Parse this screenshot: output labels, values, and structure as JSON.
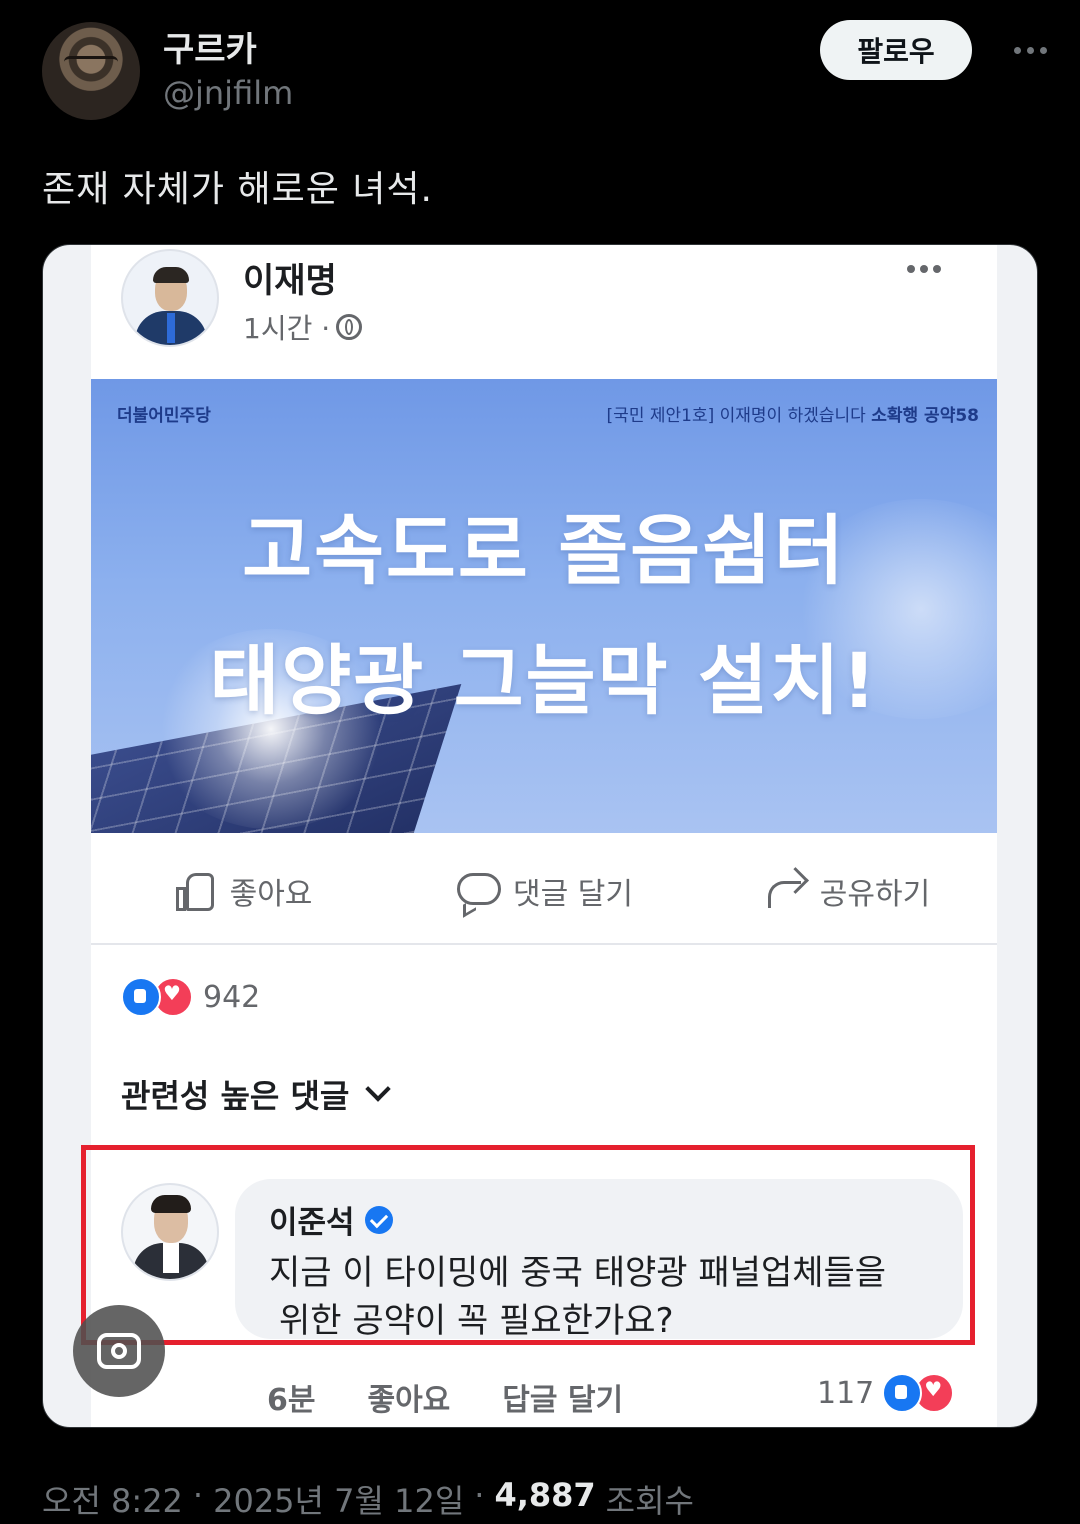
{
  "tweet": {
    "author_name": "구르카",
    "author_handle": "@jnjfilm",
    "follow_label": "팔로우",
    "text": "존재 자체가 해로운 녀석.",
    "time": "오전 8:22",
    "sep1": "·",
    "date": "2025년 7월 12일",
    "sep2": "·",
    "views_count": "4,887",
    "views_label": "조회수"
  },
  "fb_post": {
    "author_name": "이재명",
    "time": "1시간 ·",
    "banner": {
      "party": "더불어민주당",
      "tag_prefix": "[국민 제안1호] 이재명이 하겠습니다",
      "tag_bold": "소확행 공약58",
      "title_line1": "고속도로 졸음쉼터",
      "title_line2": "태양광 그늘막 설치!"
    },
    "actions": {
      "like": "좋아요",
      "comment": "댓글 달기",
      "share": "공유하기"
    },
    "reaction_count": "942",
    "sort_label": "관련성 높은 댓글",
    "comment": {
      "author": "이준석",
      "line1": "지금 이 타이밍에 중국 태양광 패널업체들을",
      "line2": "위한 공약이 꼭 필요한가요?",
      "time": "6분",
      "like_label": "좋아요",
      "reply_label": "답글 달기",
      "reaction_count": "117"
    }
  },
  "colors": {
    "background": "#000000",
    "fb_blue": "#1877f2",
    "love_red": "#f33e58",
    "highlight_red": "#e5202e"
  }
}
